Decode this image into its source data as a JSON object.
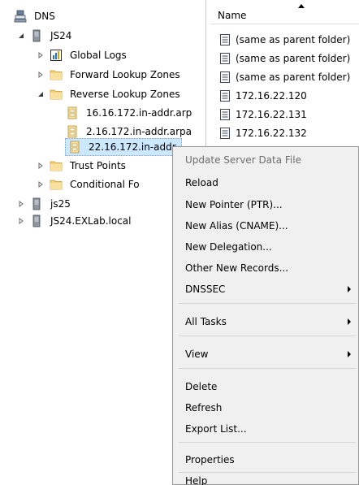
{
  "tree": {
    "root_label": "DNS",
    "server1_label": "JS24",
    "global_logs_label": "Global Logs",
    "forward_zones_label": "Forward Lookup Zones",
    "reverse_zones_label": "Reverse Lookup Zones",
    "zone1_label": "16.16.172.in-addr.arp",
    "zone2_label": "2.16.172.in-addr.arpa",
    "zone3_label": "22.16.172.in-addr.",
    "trust_points_label": "Trust Points",
    "conditional_label": "Conditional Fo",
    "server2_label": "js25",
    "server3_label": "JS24.EXLab.local"
  },
  "list": {
    "column_name": "Name",
    "rows": [
      "(same as parent folder)",
      "(same as parent folder)",
      "(same as parent folder)",
      "172.16.22.120",
      "172.16.22.131",
      "172.16.22.132"
    ]
  },
  "menu": {
    "update_server": "Update Server Data File",
    "reload": "Reload",
    "new_pointer": "New Pointer (PTR)...",
    "new_alias": "New Alias (CNAME)...",
    "new_delegation": "New Delegation...",
    "other_records": "Other New Records...",
    "dnssec": "DNSSEC",
    "all_tasks": "All Tasks",
    "view": "View",
    "delete": "Delete",
    "refresh": "Refresh",
    "export_list": "Export List...",
    "properties": "Properties",
    "help": "Help"
  }
}
